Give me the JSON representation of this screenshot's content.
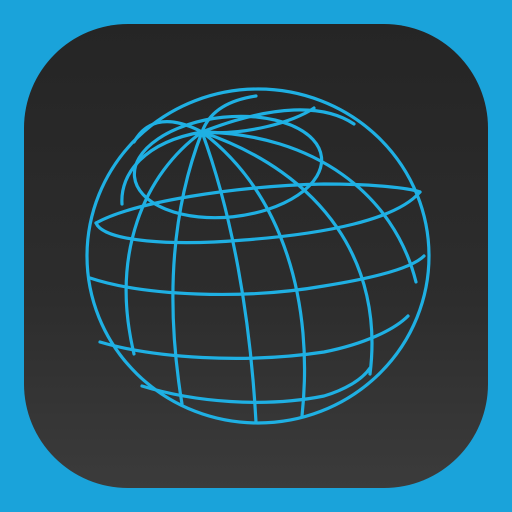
{
  "icon": {
    "name": "globe-icon",
    "colors": {
      "frame": "#1aa3da",
      "tile_top": "#252525",
      "tile_bottom": "#3b3b3b",
      "wireframe": "#1fb0e3"
    }
  }
}
